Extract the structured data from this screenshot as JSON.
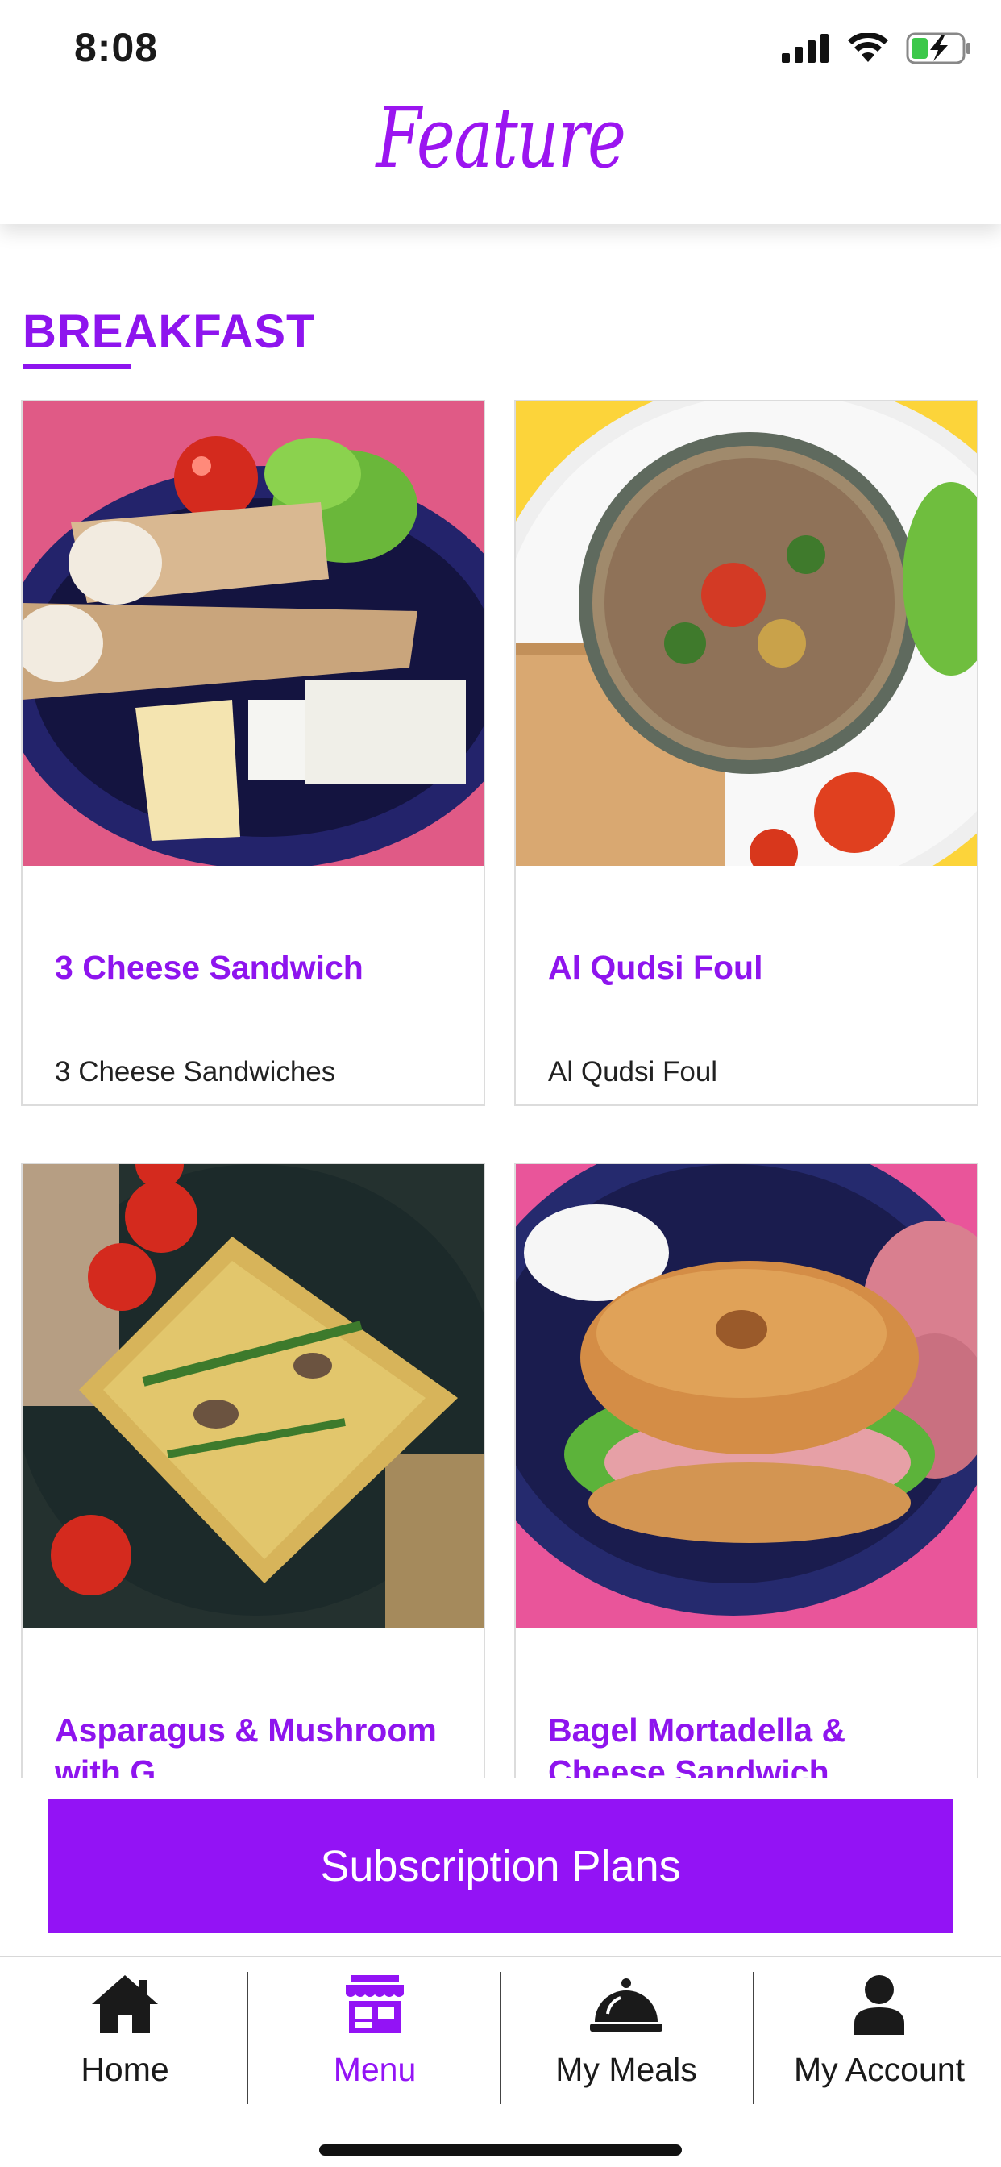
{
  "status_bar": {
    "time": "8:08"
  },
  "header": {
    "title": "Feature"
  },
  "section": {
    "title": "BREAKFAST"
  },
  "meals": [
    {
      "name": "3 Cheese Sandwich",
      "description": "3 Cheese Sandwiches",
      "image": "wraps-and-cheese-photo"
    },
    {
      "name": "Al Qudsi Foul",
      "description": "Al Qudsi Foul",
      "image": "foul-bowl-photo"
    },
    {
      "name": "Asparagus & Mushroom with G...",
      "description": "",
      "image": "frittata-photo"
    },
    {
      "name": "Bagel Mortadella & Cheese Sandwich",
      "description": "",
      "image": "bagel-sandwich-photo"
    }
  ],
  "subscription": {
    "label": "Subscription Plans"
  },
  "tabs": [
    {
      "label": "Home",
      "icon": "home-icon",
      "active": false
    },
    {
      "label": "Menu",
      "icon": "store-icon",
      "active": true
    },
    {
      "label": "My Meals",
      "icon": "cloche-icon",
      "active": false
    },
    {
      "label": "My Account",
      "icon": "person-icon",
      "active": false
    }
  ],
  "colors": {
    "accent": "#9313f5",
    "pink_bg": "#e05a86",
    "yellow_bg": "#fcd43a",
    "plate_blue": "#23236b"
  }
}
